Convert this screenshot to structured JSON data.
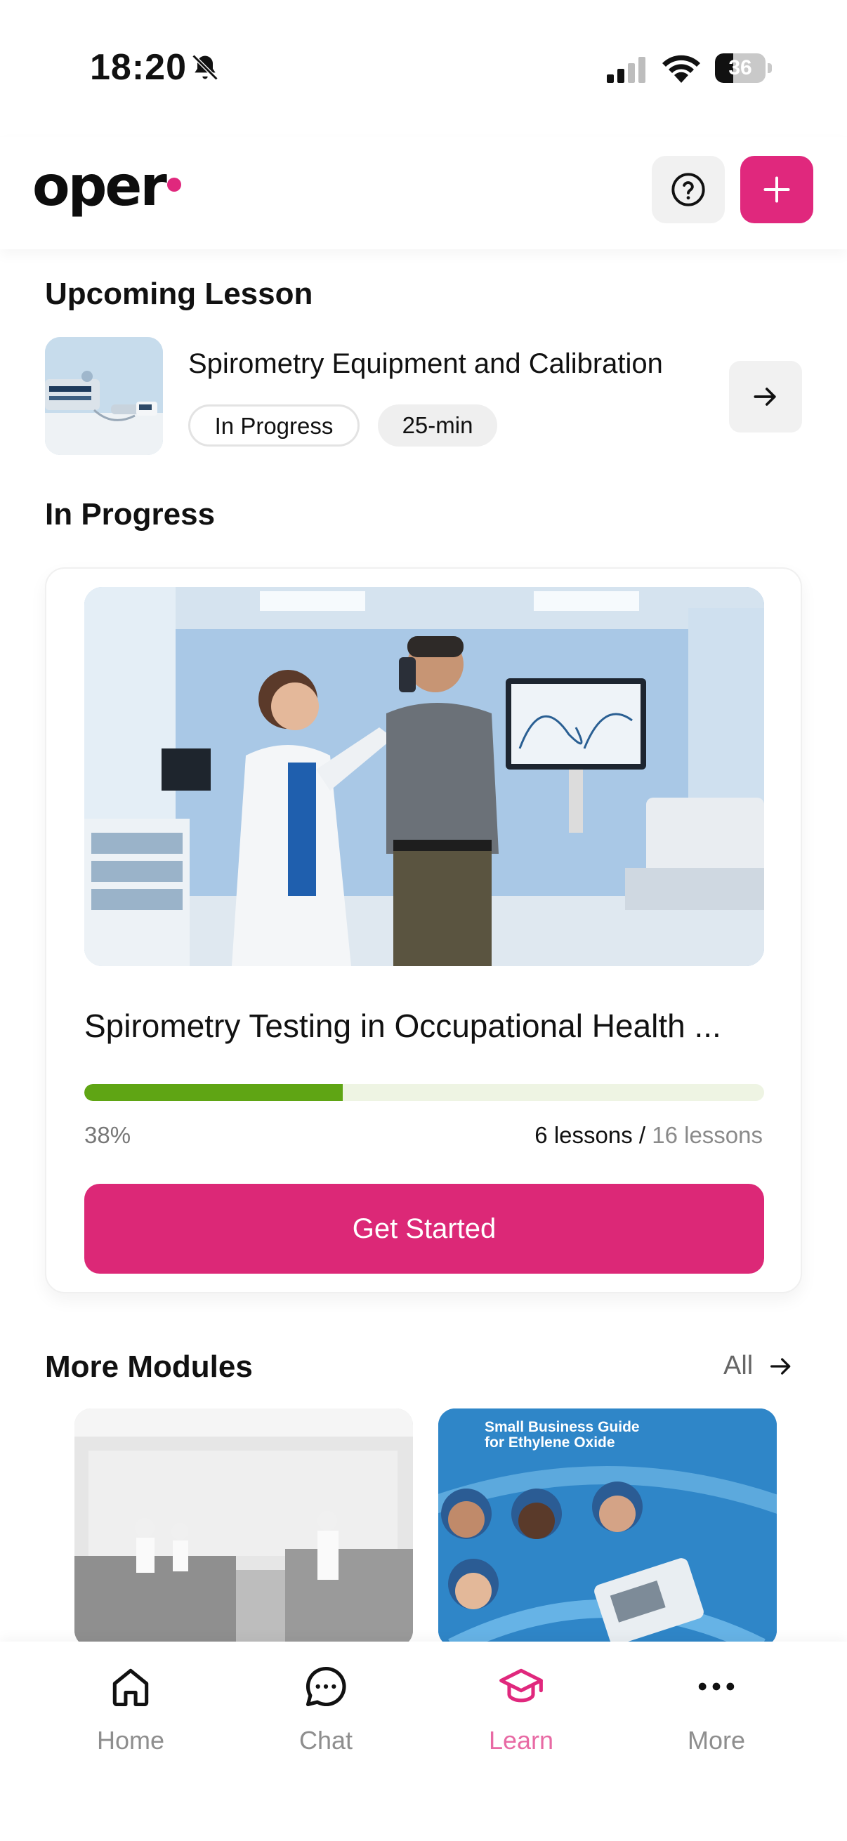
{
  "status_bar": {
    "time": "18:20",
    "battery_level": "36",
    "icons": [
      "bell-slash-icon",
      "signal-icon",
      "wifi-icon",
      "battery-icon"
    ]
  },
  "header": {
    "logo": "oper",
    "help_icon": "question-circle-icon",
    "add_icon": "plus-icon",
    "accent_color": "#e0287d"
  },
  "upcoming_lesson": {
    "section_title": "Upcoming Lesson",
    "title": "Spirometry Equipment and Calibration",
    "status": "In Progress",
    "duration": "25-min",
    "arrow_icon": "arrow-right-icon"
  },
  "in_progress": {
    "section_title": "In Progress",
    "course_title": "Spirometry Testing in Occupational Health ...",
    "progress_percent_label": "38%",
    "progress_fraction": 0.38,
    "lessons_done": "6 lessons",
    "separator": "/",
    "lessons_total": "16 lessons",
    "button_label": "Get Started",
    "progress_color": "#5fa514"
  },
  "more_modules": {
    "section_title": "More Modules",
    "all_label": "All",
    "modules": [
      {
        "caption": ""
      },
      {
        "caption": "Small Business Guide\nfor Ethylene Oxide"
      }
    ]
  },
  "bottom_nav": {
    "items": [
      {
        "label": "Home",
        "icon": "home-icon",
        "active": false
      },
      {
        "label": "Chat",
        "icon": "chat-bubble-icon",
        "active": false
      },
      {
        "label": "Learn",
        "icon": "graduation-cap-icon",
        "active": true
      },
      {
        "label": "More",
        "icon": "more-dots-icon",
        "active": false
      }
    ]
  }
}
